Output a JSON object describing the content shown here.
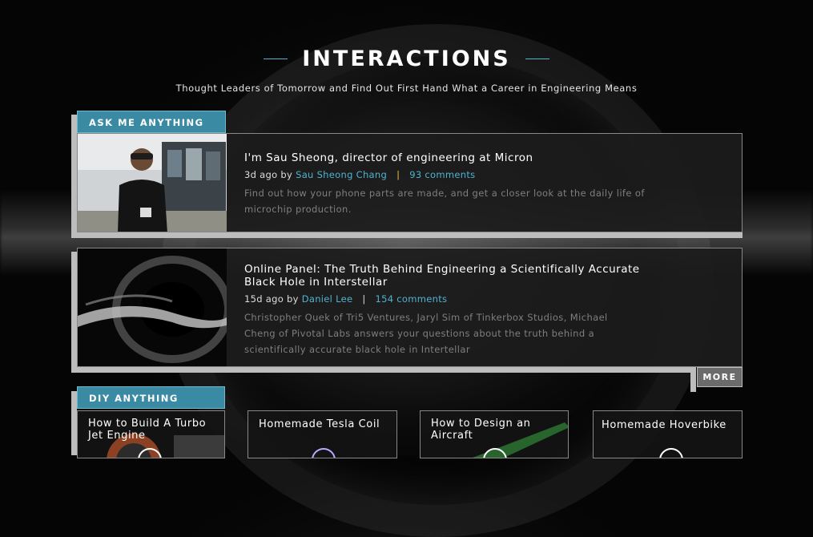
{
  "header": {
    "title": "INTERACTIONS",
    "subtitle": "Thought Leaders of Tomorrow and Find Out First Hand What a Career in Engineering Means"
  },
  "ama": {
    "tab_label": "ASK ME ANYTHING",
    "cards": [
      {
        "title": "I'm Sau Sheong, director of engineering at Micron",
        "time": "3d ago by",
        "author": "Sau Sheong Chang",
        "comments": "93 comments",
        "description": "Find out how your phone parts are made, and get a closer look at the daily life of microchip production."
      },
      {
        "title": "Online Panel: The Truth Behind Engineering a Scientifically Accurate Black Hole in Interstellar",
        "time": "15d ago by",
        "author": "Daniel Lee",
        "comments": "154 comments",
        "description": "Christopher Quek of Tri5 Ventures, Jaryl Sim of Tinkerbox Studios, Michael Cheng of Pivotal Labs answers your questions about the truth behind a scientifically accurate black hole in Intertellar"
      }
    ],
    "more_label": "MORE"
  },
  "diy": {
    "tab_label": "DIY ANYTHING",
    "items": [
      {
        "title": "How to Build A Turbo Jet Engine"
      },
      {
        "title": "Homemade Tesla Coil"
      },
      {
        "title": "How to Design an Aircraft"
      },
      {
        "title": "Homemade Hoverbike"
      }
    ]
  },
  "colors": {
    "accent": "#3a8aa3",
    "link": "#4fb3d0",
    "separator": "#e6c04a"
  }
}
